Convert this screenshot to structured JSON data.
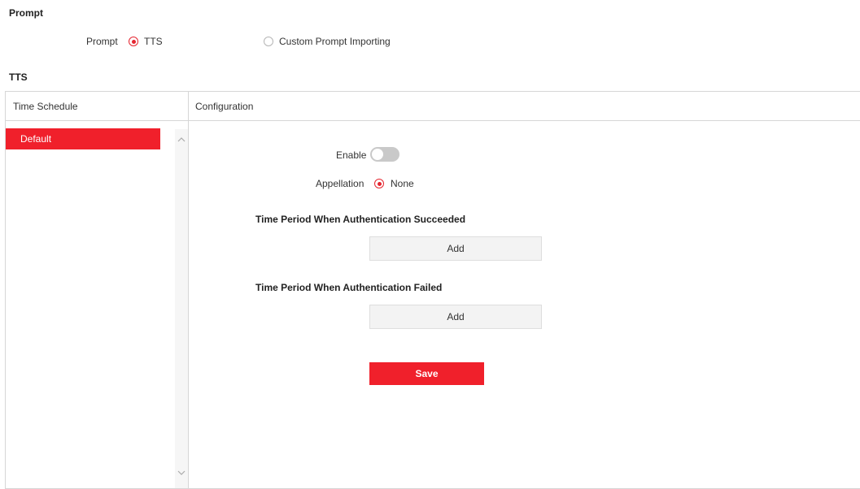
{
  "prompt_section": {
    "title": "Prompt",
    "field_label": "Prompt",
    "options": [
      {
        "label": "TTS",
        "selected": true
      },
      {
        "label": "Custom Prompt Importing",
        "selected": false
      }
    ]
  },
  "tts_section": {
    "title": "TTS",
    "columns": {
      "left": "Time Schedule",
      "right": "Configuration"
    },
    "schedules": [
      {
        "label": "Default",
        "selected": true
      }
    ],
    "config": {
      "enable_label": "Enable",
      "enable_on": false,
      "appellation_label": "Appellation",
      "appellation_option": "None",
      "success_heading": "Time Period When Authentication Succeeded",
      "success_add": "Add",
      "failed_heading": "Time Period When Authentication Failed",
      "failed_add": "Add",
      "save_label": "Save"
    }
  },
  "colors": {
    "accent": "#f0202b",
    "border": "#d6d6d6"
  },
  "icons": {
    "scroll_up": "chevron-up-icon",
    "scroll_down": "chevron-down-icon"
  }
}
